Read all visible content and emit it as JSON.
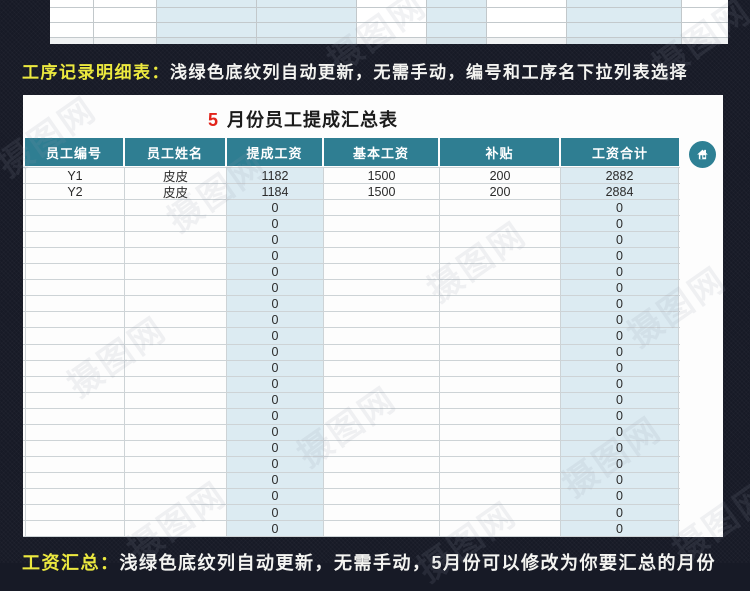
{
  "watermark": {
    "text": "摄图网"
  },
  "colors": {
    "dark_background": "#171a26",
    "header_teal": "#2f7e92",
    "home_button_teal": "#2e8094",
    "shaded_cell_blue": "#dcebf2",
    "caption_yellow": "#ece93f",
    "title_month_red": "#e2231a"
  },
  "caption_top": {
    "label": "工序记录明细表：",
    "text": "浅绿色底纹列自动更新，无需手动，编号和工序名下拉列表选择"
  },
  "caption_bottom": {
    "label": "工资汇总：",
    "text": "浅绿色底纹列自动更新，无需手动，5月份可以修改为你要汇总的月份"
  },
  "summary": {
    "title_month": "5",
    "title_text": "月份员工提成汇总表",
    "headers": [
      "员工编号",
      "员工姓名",
      "提成工资",
      "基本工资",
      "补贴",
      "工资合计"
    ],
    "shaded_columns": [
      2,
      5
    ],
    "rows": [
      [
        "Y1",
        "皮皮",
        "1182",
        "1500",
        "200",
        "2882"
      ],
      [
        "Y2",
        "皮皮",
        "1184",
        "1500",
        "200",
        "2884"
      ],
      [
        "",
        "",
        "0",
        "",
        "",
        "0"
      ],
      [
        "",
        "",
        "0",
        "",
        "",
        "0"
      ],
      [
        "",
        "",
        "0",
        "",
        "",
        "0"
      ],
      [
        "",
        "",
        "0",
        "",
        "",
        "0"
      ],
      [
        "",
        "",
        "0",
        "",
        "",
        "0"
      ],
      [
        "",
        "",
        "0",
        "",
        "",
        "0"
      ],
      [
        "",
        "",
        "0",
        "",
        "",
        "0"
      ],
      [
        "",
        "",
        "0",
        "",
        "",
        "0"
      ],
      [
        "",
        "",
        "0",
        "",
        "",
        "0"
      ],
      [
        "",
        "",
        "0",
        "",
        "",
        "0"
      ],
      [
        "",
        "",
        "0",
        "",
        "",
        "0"
      ],
      [
        "",
        "",
        "0",
        "",
        "",
        "0"
      ],
      [
        "",
        "",
        "0",
        "",
        "",
        "0"
      ],
      [
        "",
        "",
        "0",
        "",
        "",
        "0"
      ],
      [
        "",
        "",
        "0",
        "",
        "",
        "0"
      ],
      [
        "",
        "",
        "0",
        "",
        "",
        "0"
      ],
      [
        "",
        "",
        "0",
        "",
        "",
        "0"
      ],
      [
        "",
        "",
        "0",
        "",
        "",
        "0"
      ],
      [
        "",
        "",
        "0",
        "",
        "",
        "0"
      ],
      [
        "",
        "",
        "0",
        "",
        "",
        "0"
      ],
      [
        "",
        "",
        "0",
        "",
        "",
        "0"
      ]
    ]
  }
}
